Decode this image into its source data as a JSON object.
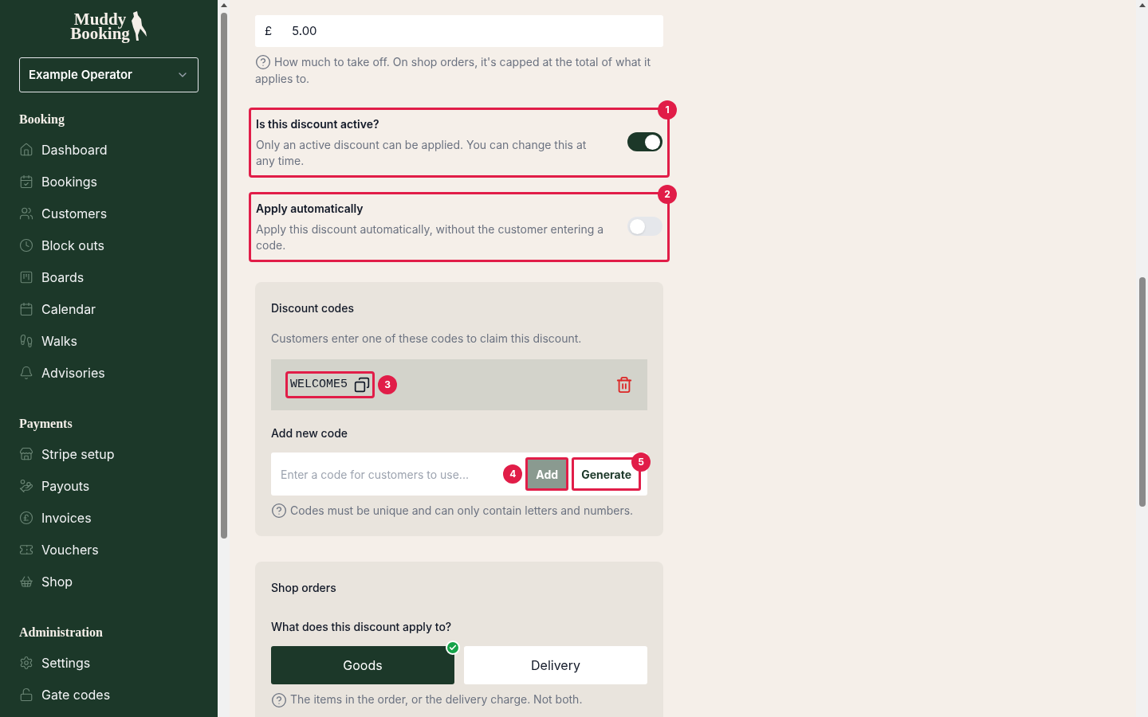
{
  "sidebar": {
    "logo": [
      "Muddy",
      "Booking"
    ],
    "operator": "Example Operator",
    "sections": [
      {
        "title": "Booking",
        "items": [
          {
            "label": "Dashboard"
          },
          {
            "label": "Bookings"
          },
          {
            "label": "Customers"
          },
          {
            "label": "Block outs"
          },
          {
            "label": "Boards"
          },
          {
            "label": "Calendar"
          },
          {
            "label": "Walks"
          },
          {
            "label": "Advisories"
          }
        ]
      },
      {
        "title": "Payments",
        "items": [
          {
            "label": "Stripe setup"
          },
          {
            "label": "Payouts"
          },
          {
            "label": "Invoices"
          },
          {
            "label": "Vouchers"
          },
          {
            "label": "Shop"
          }
        ]
      },
      {
        "title": "Administration",
        "items": [
          {
            "label": "Settings"
          },
          {
            "label": "Gate codes"
          }
        ]
      }
    ]
  },
  "amount": {
    "prefix": "£",
    "value": "5.00",
    "help": "How much to take off. On shop orders, it's capped at the total of what it applies to."
  },
  "toggles": [
    {
      "title": "Is this discount active?",
      "description": "Only an active discount can be applied. You can change this at any time.",
      "on": true,
      "marker": "1"
    },
    {
      "title": "Apply automatically",
      "description": "Apply this discount automatically, without the customer entering a code.",
      "on": false,
      "marker": "2"
    }
  ],
  "discount_codes": {
    "title": "Discount codes",
    "description": "Customers enter one of these codes to claim this discount.",
    "codes": [
      {
        "code": "WELCOME5",
        "marker": "3"
      }
    ],
    "add_label": "Add new code",
    "placeholder": "Enter a code for customers to use...",
    "add_button": {
      "label": "Add",
      "marker": "4",
      "disabled": true
    },
    "generate_button": {
      "label": "Generate",
      "marker": "5"
    },
    "help": "Codes must be unique and can only contain letters and numbers."
  },
  "shop_orders": {
    "title": "Shop orders",
    "question": "What does this discount apply to?",
    "options": [
      {
        "label": "Goods",
        "selected": true
      },
      {
        "label": "Delivery",
        "selected": false
      }
    ],
    "help": "The items in the order, or the delivery charge. Not both."
  }
}
